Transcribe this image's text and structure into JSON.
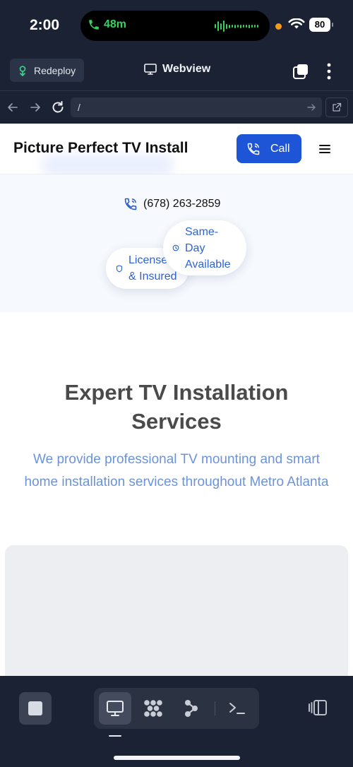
{
  "status_bar": {
    "time": "2:00",
    "call_duration": "48m",
    "battery": "80",
    "accent_green": "#33d35e",
    "privacy_dot_color": "#f59a1b"
  },
  "toolbar": {
    "redeploy_label": "Redeploy",
    "title": "Webview"
  },
  "urlbar": {
    "url": "/"
  },
  "site": {
    "title": "Picture Perfect TV Install",
    "call_label": "Call",
    "brand_color": "#1e54d6",
    "phone": "(678) 263-2859",
    "badges": {
      "licensed_line1": "License",
      "licensed_line2": "& Insured",
      "sameday_line1": "Same-",
      "sameday_line2": "Day",
      "sameday_line3": "Available"
    },
    "services_heading": "Expert TV Installation Services",
    "services_description": "We provide professional TV mounting and smart home installation services throughout Metro Atlanta"
  },
  "dock": {
    "items": [
      "stop",
      "webview",
      "apps",
      "workflows",
      "terminal",
      "side-panel"
    ],
    "active": "webview"
  }
}
